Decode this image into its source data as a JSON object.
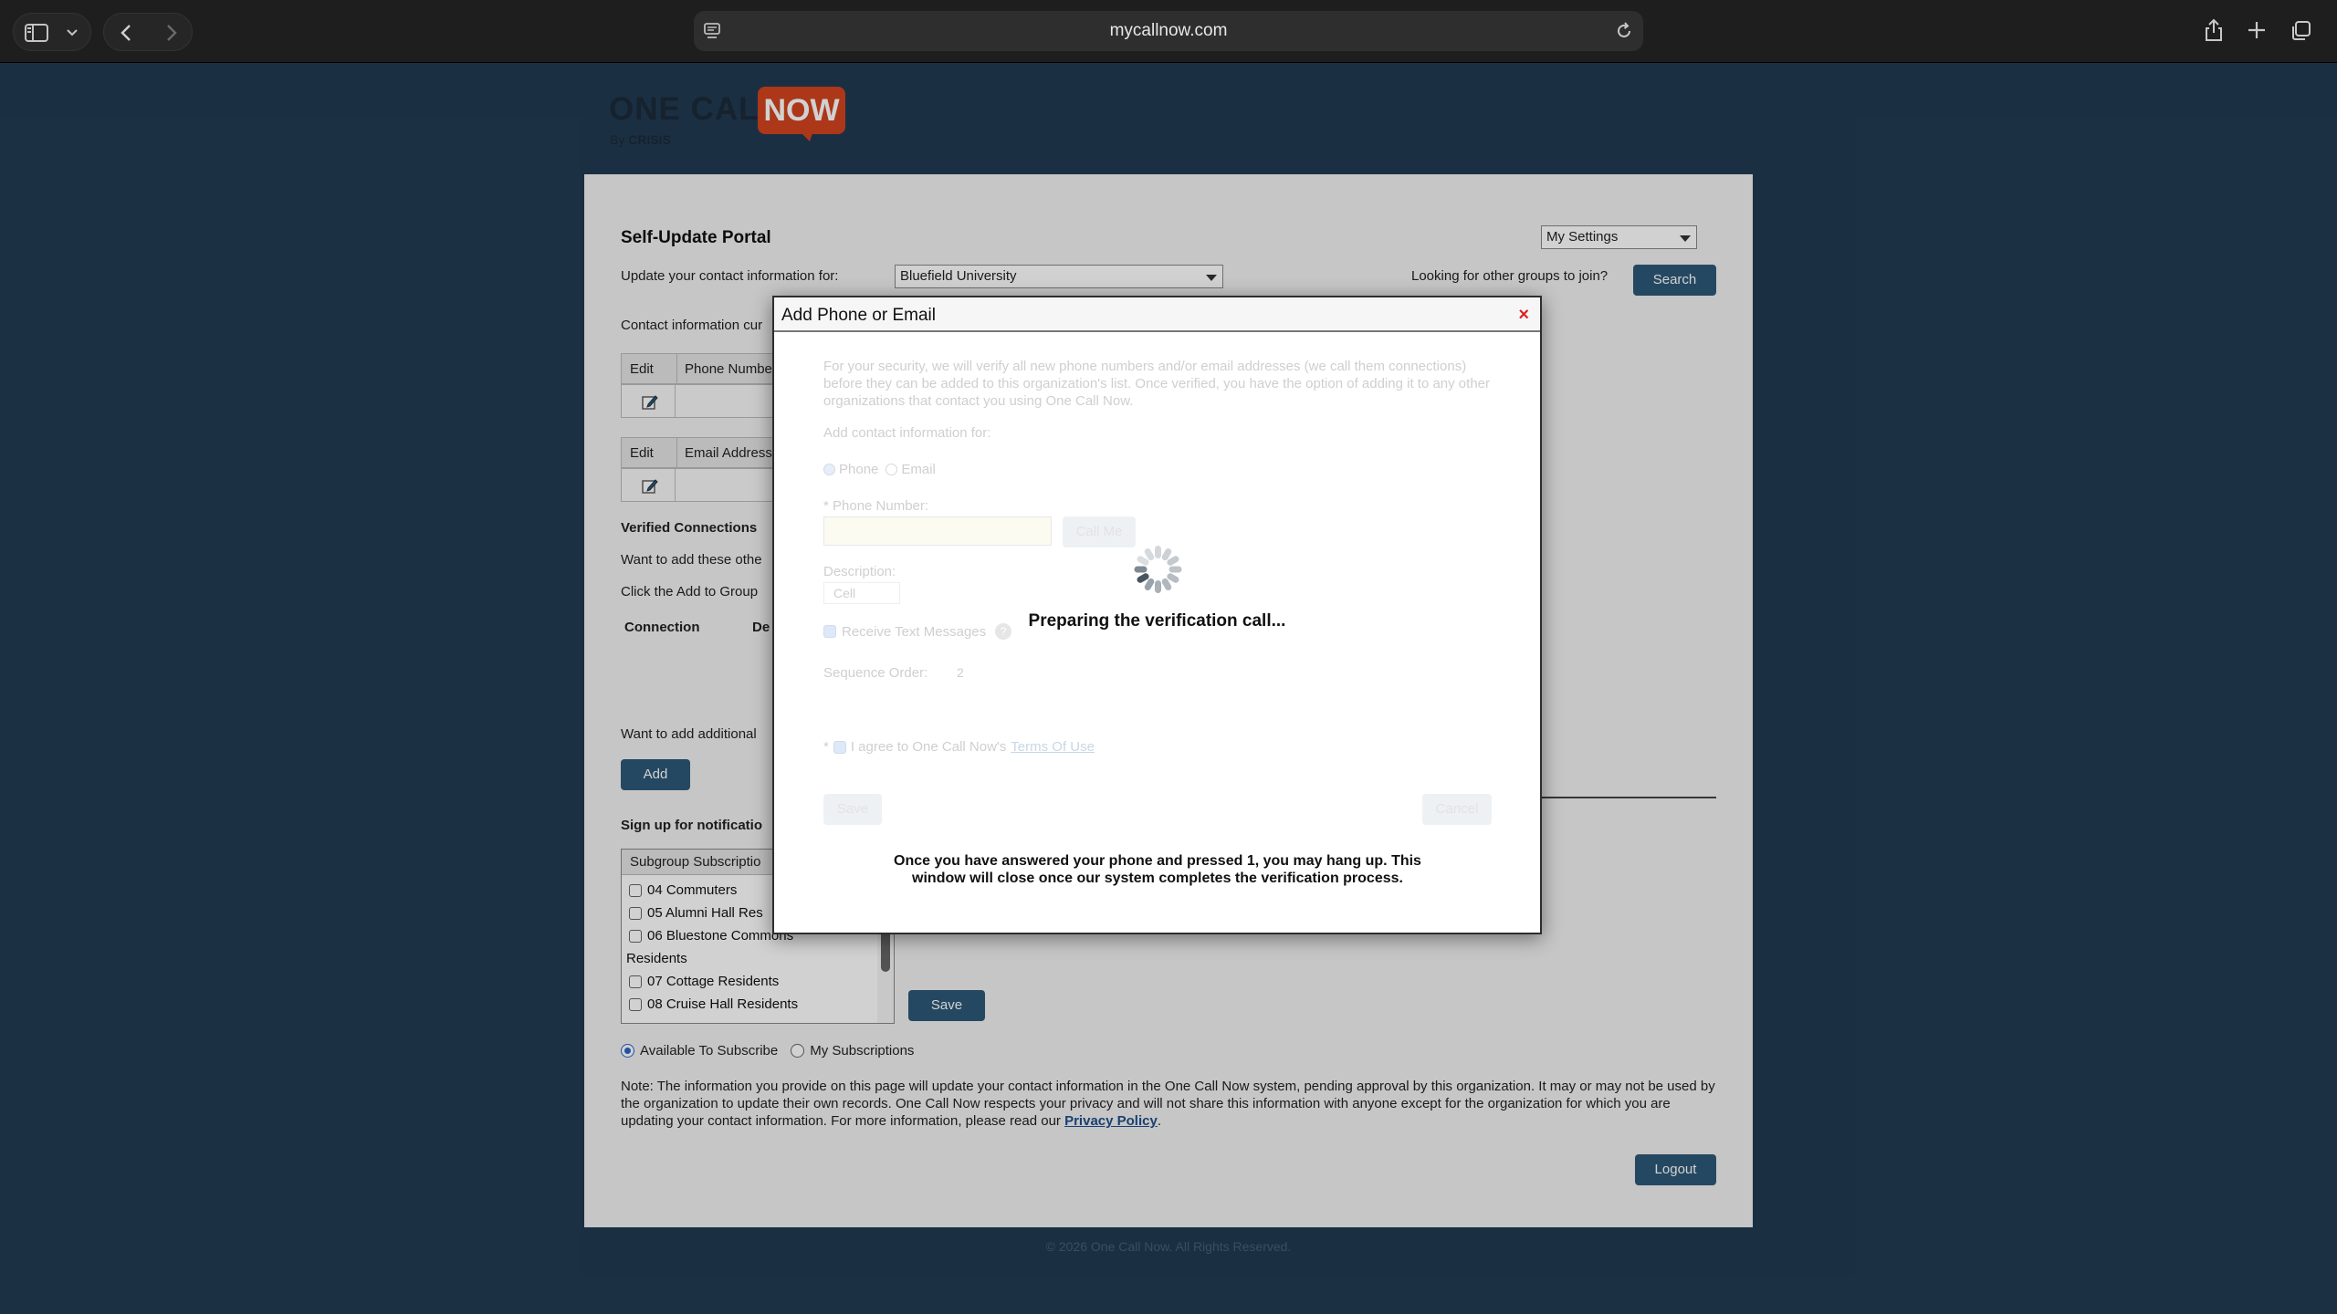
{
  "browser": {
    "url": "mycallnow.com"
  },
  "logo": {
    "one_call": "ONE CALL",
    "now": "NOW",
    "by": "By",
    "crisis": "CRISIS"
  },
  "portal": {
    "title": "Self-Update Portal",
    "settings_select": "My Settings",
    "update_label": "Update your contact information for:",
    "org_select": "Bluefield University",
    "other_groups_label": "Looking for other groups to join?",
    "search_button": "Search",
    "contact_info_label": "Contact information cur",
    "phone_table": {
      "col_edit": "Edit",
      "col_phone": "Phone Numbe"
    },
    "email_table": {
      "col_edit": "Edit",
      "col_email": "Email Address"
    },
    "verified_heading": "Verified Connections",
    "want_add_text": "Want to add these othe",
    "click_add_text": "Click the Add to Group",
    "conn_col_connection": "Connection",
    "conn_col_de": "De",
    "want_additional_text": "Want to add additional",
    "add_button": "Add",
    "signup_heading": "Sign up for notificatio",
    "subscriptions": {
      "header": "Subgroup Subscriptio",
      "items": [
        "04 Commuters",
        "05 Alumni Hall Res",
        "06 Bluestone Commons",
        "Residents",
        "07 Cottage Residents",
        "08 Cruise Hall Residents"
      ]
    },
    "save_button": "Save",
    "radio_available": "Available To Subscribe",
    "radio_my": "My Subscriptions",
    "note": "Note: The information you provide on this page will update your contact information in the One Call Now system, pending approval by this organization. It may or may not be used by the organization to update their own records. One Call Now respects your privacy and will not share this information with anyone except for the organization for which you are updating your contact information. For more information, please read our",
    "privacy_link": "Privacy Policy",
    "note_end": ".",
    "logout_button": "Logout",
    "footer": "© 2026 One Call Now. All Rights Reserved."
  },
  "modal": {
    "title": "Add Phone or Email",
    "close": "×",
    "security_text": "For your security, we will verify all new phone numbers and/or email addresses (we call them connections) before they can be added to this organization's list. Once verified, you have the option of adding it to any other organizations that contact you using One Call Now.",
    "add_contact_label": "Add contact information for:",
    "radio_phone": "Phone",
    "radio_email": "Email",
    "phone_label": "* Phone Number:",
    "call_me_button": "Call Me",
    "description_label": "Description:",
    "description_value": "Cell",
    "receive_text_label": "Receive Text Messages",
    "help_glyph": "?",
    "sequence_label": "Sequence Order:",
    "sequence_value": "2",
    "agree_prefix": "*",
    "agree_text": "I agree to One Call Now's",
    "terms_link": "Terms Of Use",
    "save_button": "Save",
    "cancel_button": "Cancel",
    "preparing_text": "Preparing the verification call...",
    "instructions": "Once you have answered your phone and pressed 1, you may hang up. This window will close once our system completes the verification process."
  }
}
